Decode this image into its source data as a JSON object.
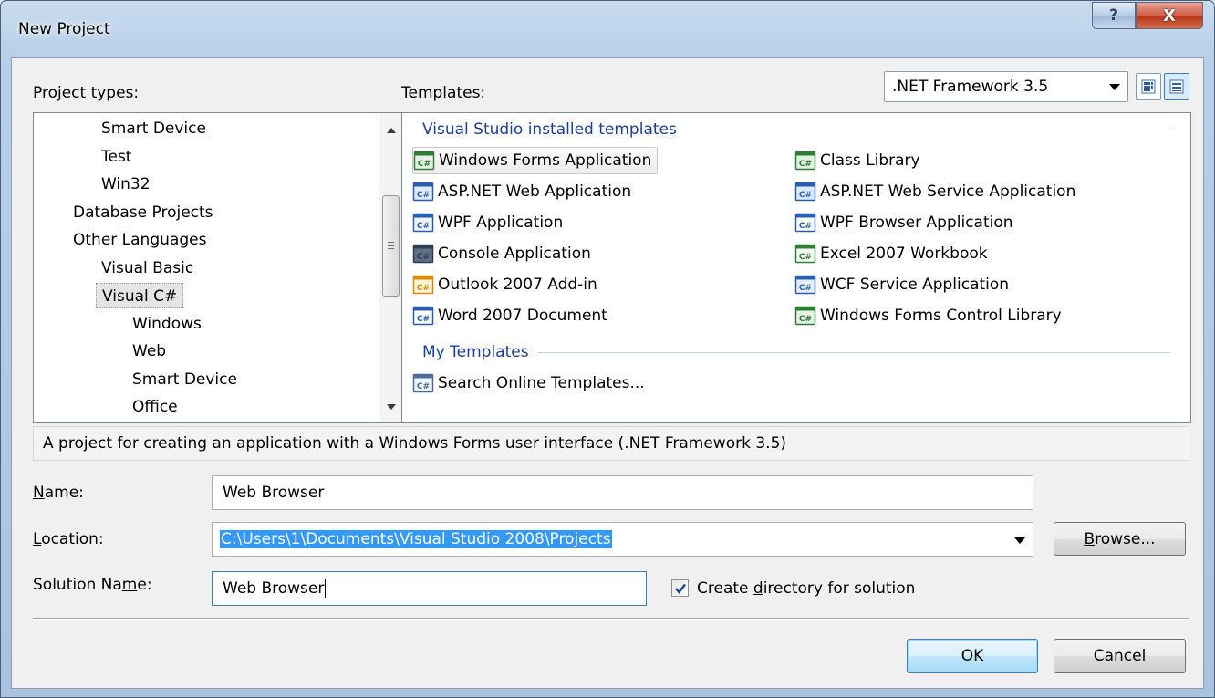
{
  "window": {
    "title": "New Project",
    "help_glyph": "?",
    "close_glyph": "X"
  },
  "labels": {
    "project_types_prefix": "P",
    "project_types_rest": "roject types:",
    "templates_prefix": "T",
    "templates_rest": "emplates:"
  },
  "framework": {
    "selected": ".NET Framework 3.5"
  },
  "project_types": [
    {
      "label": "Smart Device",
      "indent": 2
    },
    {
      "label": "Test",
      "indent": 2
    },
    {
      "label": "Win32",
      "indent": 2
    },
    {
      "label": "Database Projects",
      "indent": 1
    },
    {
      "label": "Other Languages",
      "indent": 1
    },
    {
      "label": "Visual Basic",
      "indent": 2
    },
    {
      "label": "Visual C#",
      "indent": 2,
      "selected": true
    },
    {
      "label": "Windows",
      "indent": 3
    },
    {
      "label": "Web",
      "indent": 3
    },
    {
      "label": "Smart Device",
      "indent": 3
    },
    {
      "label": "Office",
      "indent": 3
    }
  ],
  "templates": {
    "installed_header": "Visual Studio installed templates",
    "installed_left": [
      {
        "label": "Windows Forms Application",
        "icon": "winforms-icon",
        "selected": true
      },
      {
        "label": "ASP.NET Web Application",
        "icon": "aspnet-web-icon"
      },
      {
        "label": "WPF Application",
        "icon": "wpf-icon"
      },
      {
        "label": "Console Application",
        "icon": "console-icon"
      },
      {
        "label": "Outlook 2007 Add-in",
        "icon": "outlook-icon"
      },
      {
        "label": "Word 2007 Document",
        "icon": "word-icon"
      }
    ],
    "installed_right": [
      {
        "label": "Class Library",
        "icon": "class-library-icon"
      },
      {
        "label": "ASP.NET Web Service Application",
        "icon": "web-service-icon"
      },
      {
        "label": "WPF Browser Application",
        "icon": "wpf-browser-icon"
      },
      {
        "label": "Excel 2007 Workbook",
        "icon": "excel-icon"
      },
      {
        "label": "WCF Service Application",
        "icon": "wcf-icon"
      },
      {
        "label": "Windows Forms Control Library",
        "icon": "control-library-icon"
      }
    ],
    "my_header": "My Templates",
    "my_templates": [
      {
        "label": "Search Online Templates...",
        "icon": "search-online-icon"
      }
    ]
  },
  "description": "A project for creating an application with a Windows Forms user interface (.NET Framework 3.5)",
  "form": {
    "name_label_u": "N",
    "name_label_rest": "ame:",
    "name_value": "Web Browser",
    "location_label_u": "L",
    "location_label_rest": "ocation:",
    "location_value": "C:\\Users\\1\\Documents\\Visual Studio 2008\\Projects",
    "solution_label_a": "Solution Na",
    "solution_label_u": "m",
    "solution_label_b": "e:",
    "solution_value": "Web Browser",
    "create_dir_a": "Create ",
    "create_dir_u": "d",
    "create_dir_b": "irectory for solution",
    "create_dir_checked": true
  },
  "buttons": {
    "browse_u": "B",
    "browse_rest": "rowse...",
    "ok": "OK",
    "cancel": "Cancel"
  },
  "colors": {
    "accent_blue": "#1e3f99",
    "selection": "#3399ff"
  }
}
